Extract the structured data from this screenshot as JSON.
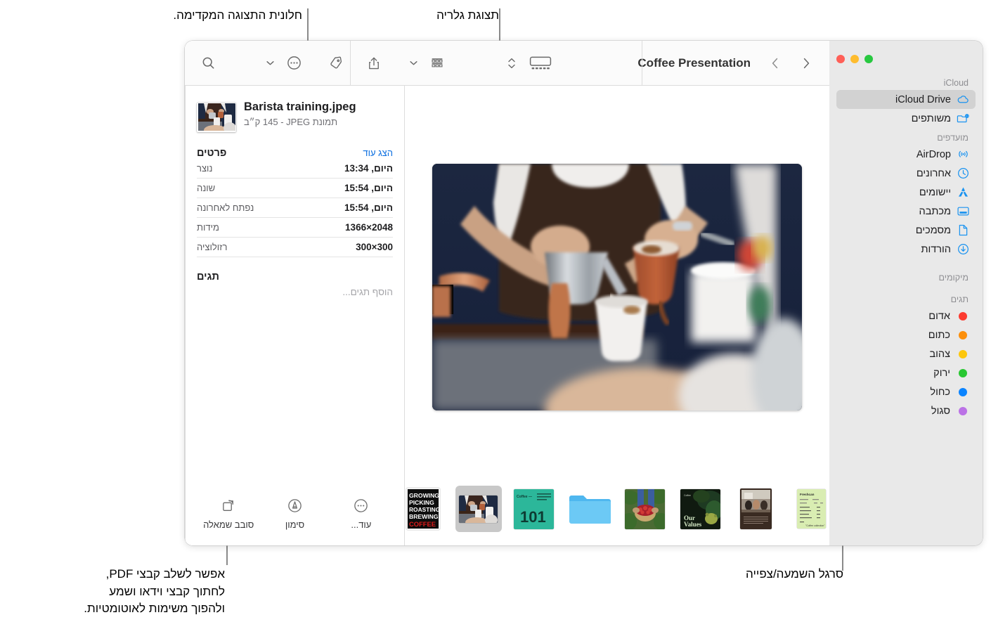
{
  "annotations": {
    "top_left": "חלונית התצוגה המקדימה.",
    "top_right": "תצוגת גלריה",
    "bottom_left": "אפשר לשלב קבצי PDF,\nלחתוך קבצי וידאו ושמע\nולהפוך משימות לאוטומטיות.",
    "bottom_right": "סרגל השמעה/צפייה"
  },
  "toolbar": {
    "title": "Coffee Presentation",
    "search_icon": "search-icon",
    "more_icon": "more-circle-icon",
    "chevron_icon": "chevron-down-icon",
    "tag_icon": "tag-icon",
    "share_icon": "share-icon",
    "group_icon": "group-view-icon",
    "sort_icon": "sort-updown-icon",
    "gallery_icon": "gallery-view-icon",
    "back_icon": "chevron-back-icon",
    "forward_icon": "chevron-forward-icon"
  },
  "window_controls": {
    "close": "#ff5f57",
    "minimize": "#febc2e",
    "zoom": "#28c840"
  },
  "sidebar": {
    "sections": [
      {
        "title": "iCloud",
        "items": [
          {
            "label": "iCloud Drive",
            "icon": "icloud-icon",
            "selected": true,
            "ltr": true
          },
          {
            "label": "משותפים",
            "icon": "shared-folder-icon",
            "selected": false,
            "ltr": false
          }
        ]
      },
      {
        "title": "מועדפים",
        "items": [
          {
            "label": "AirDrop",
            "icon": "airdrop-icon",
            "selected": false,
            "ltr": true
          },
          {
            "label": "אחרונים",
            "icon": "clock-icon",
            "selected": false,
            "ltr": false
          },
          {
            "label": "יישומים",
            "icon": "applications-icon",
            "selected": false,
            "ltr": false
          },
          {
            "label": "מכתבה",
            "icon": "desktop-icon",
            "selected": false,
            "ltr": false
          },
          {
            "label": "מסמכים",
            "icon": "document-icon",
            "selected": false,
            "ltr": false
          },
          {
            "label": "הורדות",
            "icon": "downloads-icon",
            "selected": false,
            "ltr": false
          }
        ]
      },
      {
        "title": "מיקומים",
        "items": []
      },
      {
        "title": "תגים",
        "items": [
          {
            "label": "אדום",
            "color": "#fc3b30",
            "tag": true
          },
          {
            "label": "כתום",
            "color": "#fc8f0b",
            "tag": true
          },
          {
            "label": "צהוב",
            "color": "#fdc70d",
            "tag": true
          },
          {
            "label": "ירוק",
            "color": "#29c732",
            "tag": true
          },
          {
            "label": "כחול",
            "color": "#0b84ff",
            "tag": true
          },
          {
            "label": "סגול",
            "color": "#bb72e6",
            "tag": true
          }
        ]
      }
    ]
  },
  "inspector": {
    "file_name": "Barista training.jpeg",
    "file_sub": "תמונת JPEG ‏- 145 ק״ב",
    "details_title": "פרטים",
    "details_link": "הצג עוד",
    "rows": [
      {
        "key": "נוצר",
        "value": "היום, 13:34"
      },
      {
        "key": "שונה",
        "value": "היום, 15:54"
      },
      {
        "key": "נפתח לאחרונה",
        "value": "היום, 15:54"
      },
      {
        "key": "מידות",
        "value": "1366×2048"
      },
      {
        "key": "רזולוציה",
        "value": "300×300"
      }
    ],
    "tags_title": "תגים",
    "tags_placeholder": "הוסף תגים...",
    "actions": [
      {
        "label": "עוד...",
        "icon": "more-circle-icon"
      },
      {
        "label": "סימון",
        "icon": "markup-icon"
      },
      {
        "label": "סובב שמאלה",
        "icon": "rotate-left-icon"
      }
    ]
  },
  "gallery": {
    "hero_alt": "barista-pouring-coffee-photo",
    "thumbnails": [
      {
        "name": "spreadsheet-thumbnail",
        "selected": false
      },
      {
        "name": "meeting-photo-thumbnail",
        "selected": false
      },
      {
        "name": "our-values-thumbnail",
        "selected": false
      },
      {
        "name": "berries-photo-thumbnail",
        "selected": false
      },
      {
        "name": "folder-thumbnail",
        "selected": false
      },
      {
        "name": "coffee-101-thumbnail",
        "selected": false
      },
      {
        "name": "barista-training-thumbnail",
        "selected": true
      },
      {
        "name": "growing-picking-roasting-thumbnail",
        "selected": false
      }
    ],
    "thumbnail_text": {
      "our_values": "Our\nValues",
      "coffee_101_label": "Coffee —",
      "coffee_101_number": "101",
      "poster_lines": [
        "GROWING",
        "PICKING",
        "ROASTING",
        "BREWING",
        "COFFEE"
      ],
      "spreadsheet_title": "Freshcan"
    }
  }
}
